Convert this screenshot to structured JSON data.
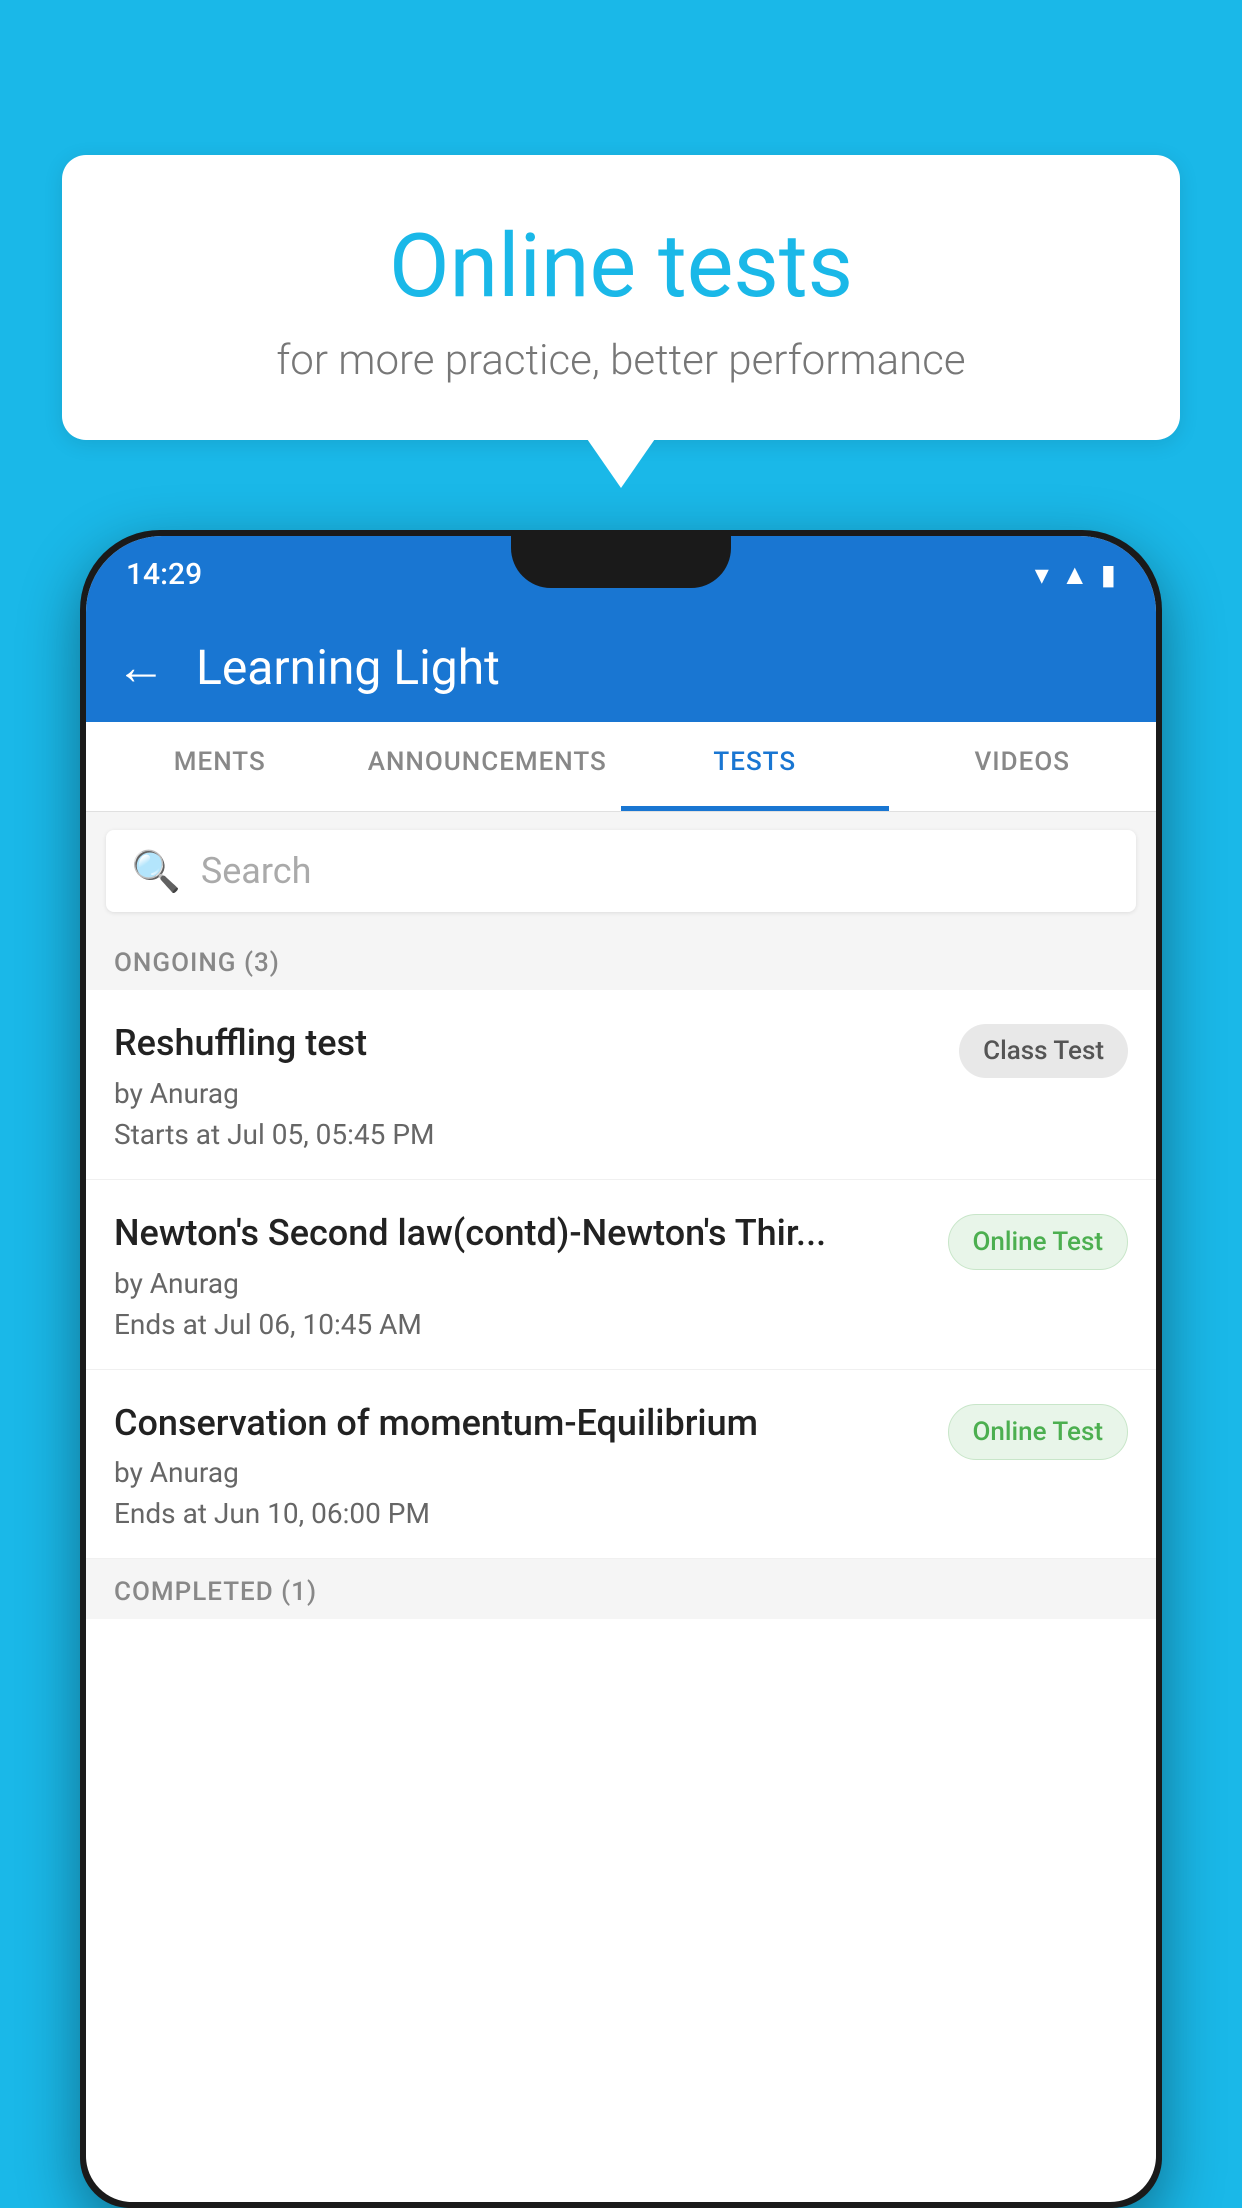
{
  "background_color": "#1ab8e8",
  "speech_bubble": {
    "title": "Online tests",
    "subtitle": "for more practice, better performance"
  },
  "status_bar": {
    "time": "14:29",
    "icons": [
      "wifi",
      "signal",
      "battery"
    ]
  },
  "app_bar": {
    "title": "Learning Light",
    "back_label": "←"
  },
  "tabs": [
    {
      "label": "MENTS",
      "active": false
    },
    {
      "label": "ANNOUNCEMENTS",
      "active": false
    },
    {
      "label": "TESTS",
      "active": true
    },
    {
      "label": "VIDEOS",
      "active": false
    }
  ],
  "search": {
    "placeholder": "Search"
  },
  "sections": [
    {
      "title": "ONGOING (3)",
      "items": [
        {
          "name": "Reshuffling test",
          "author": "by Anurag",
          "time": "Starts at  Jul 05, 05:45 PM",
          "badge": "Class Test",
          "badge_type": "class"
        },
        {
          "name": "Newton's Second law(contd)-Newton's Thir...",
          "author": "by Anurag",
          "time": "Ends at  Jul 06, 10:45 AM",
          "badge": "Online Test",
          "badge_type": "online"
        },
        {
          "name": "Conservation of momentum-Equilibrium",
          "author": "by Anurag",
          "time": "Ends at  Jun 10, 06:00 PM",
          "badge": "Online Test",
          "badge_type": "online"
        }
      ]
    }
  ],
  "completed_section": {
    "title": "COMPLETED (1)"
  }
}
